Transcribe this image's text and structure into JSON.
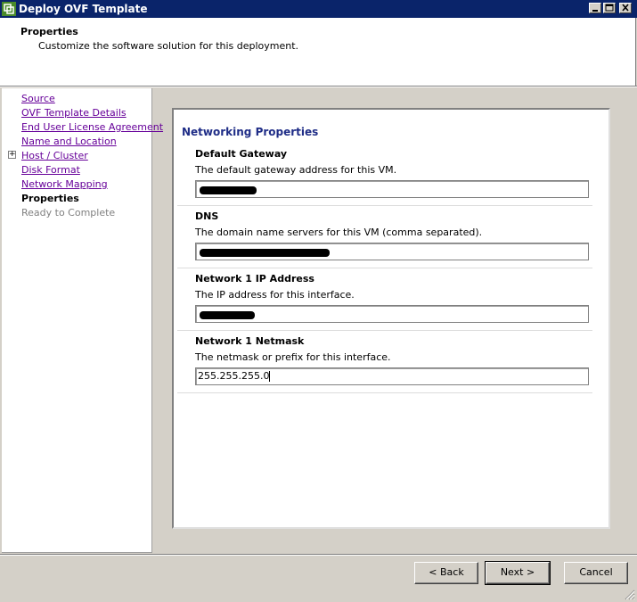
{
  "window": {
    "title": "Deploy OVF Template",
    "icon": "vmware-icon",
    "controls": [
      "minimize-icon",
      "maximize-icon",
      "close-icon"
    ]
  },
  "header": {
    "title": "Properties",
    "subtitle": "Customize the software solution for this deployment."
  },
  "nav": {
    "items": [
      {
        "label": "Source",
        "state": "link"
      },
      {
        "label": "OVF Template Details",
        "state": "link"
      },
      {
        "label": "End User License Agreement",
        "state": "link"
      },
      {
        "label": "Name and Location",
        "state": "link"
      },
      {
        "label": "Host / Cluster",
        "state": "link",
        "expandable": true
      },
      {
        "label": "Disk Format",
        "state": "link"
      },
      {
        "label": "Network Mapping",
        "state": "link"
      },
      {
        "label": "Properties",
        "state": "current"
      },
      {
        "label": "Ready to Complete",
        "state": "disabled"
      }
    ]
  },
  "main": {
    "section_title": "Networking Properties",
    "properties": [
      {
        "label": "Default Gateway",
        "description": "The default gateway address for this VM.",
        "value": "",
        "redacted": true
      },
      {
        "label": "DNS",
        "description": "The domain name servers for this VM (comma separated).",
        "value": "",
        "redacted": true
      },
      {
        "label": "Network 1 IP Address",
        "description": "The IP address for this interface.",
        "value": "",
        "redacted": true
      },
      {
        "label": "Network 1 Netmask",
        "description": "The netmask or prefix for this interface.",
        "value": "255.255.255.0",
        "redacted": false
      }
    ]
  },
  "buttons": {
    "back": "< Back",
    "next": "Next >",
    "cancel": "Cancel"
  },
  "colors": {
    "titlebar": "#0a246a",
    "section_title": "#1f2d87",
    "link": "#660099"
  }
}
